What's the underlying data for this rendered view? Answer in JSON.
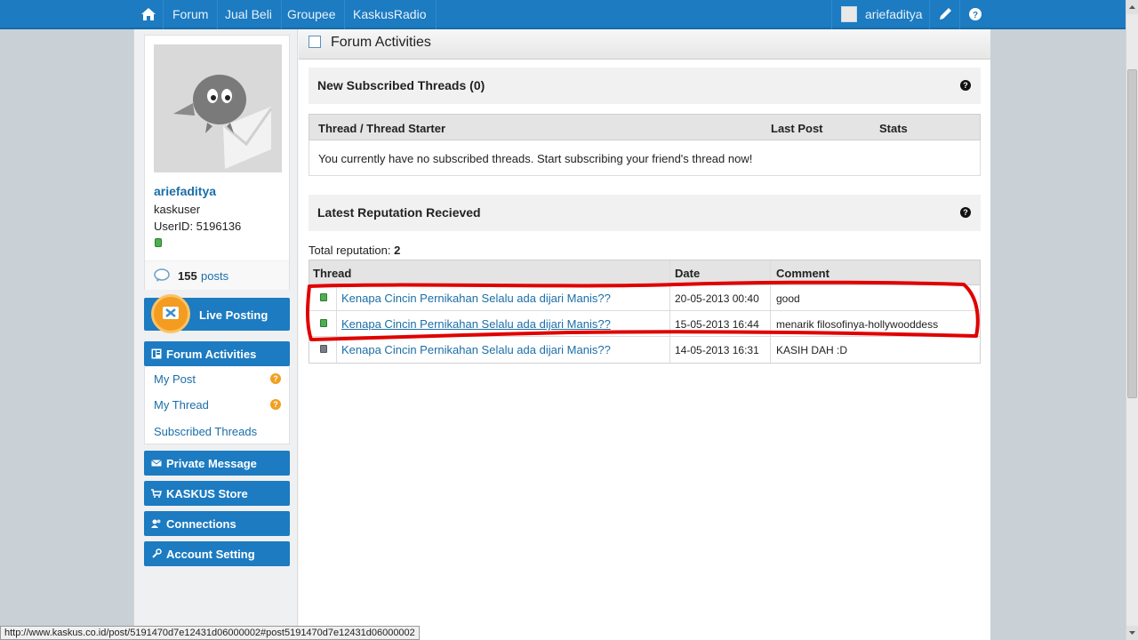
{
  "nav": {
    "items": [
      "Forum",
      "Jual Beli",
      "Groupee",
      "KaskusRadio"
    ],
    "username": "ariefaditya"
  },
  "profile": {
    "username": "ariefaditya",
    "title": "kaskuser",
    "user_id": "UserID: 5196136",
    "posts_count": "155",
    "posts_label": "posts"
  },
  "sidebar": {
    "live_posting": "Live Posting",
    "forum_activities": "Forum Activities",
    "sub_items": [
      "My Post",
      "My Thread",
      "Subscribed Threads"
    ],
    "private_message": "Private Message",
    "store": "KASKUS Store",
    "connections": "Connections",
    "account_setting": "Account Setting"
  },
  "main": {
    "title": "Forum Activities",
    "subscribed": {
      "title": "New Subscribed Threads (0)",
      "columns": [
        "Thread / Thread Starter",
        "Last Post",
        "Stats"
      ],
      "empty_message": "You currently have no subscribed threads. Start subscribing your friend's thread now!"
    },
    "reputation": {
      "title": "Latest Reputation Recieved",
      "total_label": "Total reputation: ",
      "total_value": "2",
      "columns": [
        "Thread",
        "Date",
        "Comment"
      ],
      "rows": [
        {
          "thread": "Kenapa Cincin Pernikahan Selalu ada dijari Manis??",
          "date": "20-05-2013 00:40",
          "comment": "good",
          "status": "positive"
        },
        {
          "thread": "Kenapa Cincin Pernikahan Selalu ada dijari Manis??",
          "date": "15-05-2013 16:44",
          "comment": "menarik filosofinya-hollywooddess",
          "status": "positive"
        },
        {
          "thread": "Kenapa Cincin Pernikahan Selalu ada dijari Manis??",
          "date": "14-05-2013 16:31",
          "comment": "KASIH DAH :D",
          "status": "neutral"
        }
      ]
    }
  },
  "colors": {
    "brand_blue": "#1c7bc1",
    "link_blue": "#1b6ea8",
    "positive": "#4caf50",
    "neutral": "#7a7a8a",
    "annotation_red": "#e00000"
  },
  "statusbar": {
    "url": "http://www.kaskus.co.id/post/5191470d7e12431d06000002#post5191470d7e12431d06000002"
  }
}
